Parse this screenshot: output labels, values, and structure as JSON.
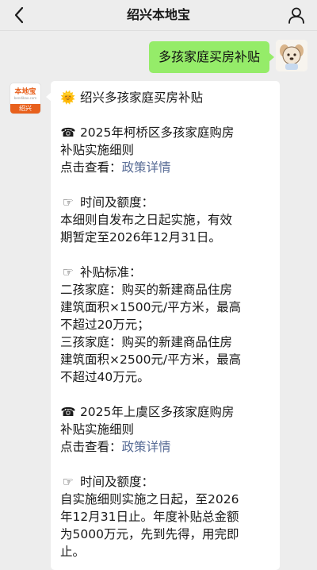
{
  "header": {
    "title": "绍兴本地宝",
    "back_icon": "chevron-left-icon",
    "profile_icon": "person-icon"
  },
  "user_message": {
    "text": "多孩家庭买房补贴"
  },
  "bot_avatar": {
    "logo_text": "本地宝",
    "logo_sub": "bendibao.com",
    "city_label": "绍兴"
  },
  "bot_message": {
    "heading_icon": "🌞",
    "heading": "绍兴多孩家庭买房补贴",
    "section1": {
      "icon": "☎",
      "title_line1": "2025年柯桥区多孩家庭购房",
      "title_line2": "补贴实施细则",
      "view_prefix": "点击查看：",
      "view_link": "政策详情",
      "time_icon": "☞",
      "time_label": "时间及额度：",
      "time_text_line1": "本细则自发布之日起实施，有效",
      "time_text_line2": "期暂定至2026年12月31日。",
      "std_icon": "☞",
      "std_label": "补贴标准：",
      "std_lines": [
        "二孩家庭：购买的新建商品住房",
        "建筑面积×1500元/平方米，最高",
        "不超过20万元；",
        "三孩家庭：购买的新建商品住房",
        "建筑面积×2500元/平方米，最高",
        "不超过40万元。"
      ]
    },
    "section2": {
      "icon": "☎",
      "title_line1": "2025年上虞区多孩家庭购房",
      "title_line2": "补贴实施细则",
      "view_prefix": "点击查看：",
      "view_link": "政策详情",
      "time_icon": "☞",
      "time_label": "时间及额度：",
      "time_lines": [
        "自实施细则实施之日起，至2026",
        "年12月31日止。年度补贴总金额",
        "为5000万元，先到先得，用完即",
        "止。"
      ]
    }
  },
  "colors": {
    "background": "#ededed",
    "user_bubble": "#95ec69",
    "link": "#576b95",
    "logo_orange": "#e8601c"
  }
}
